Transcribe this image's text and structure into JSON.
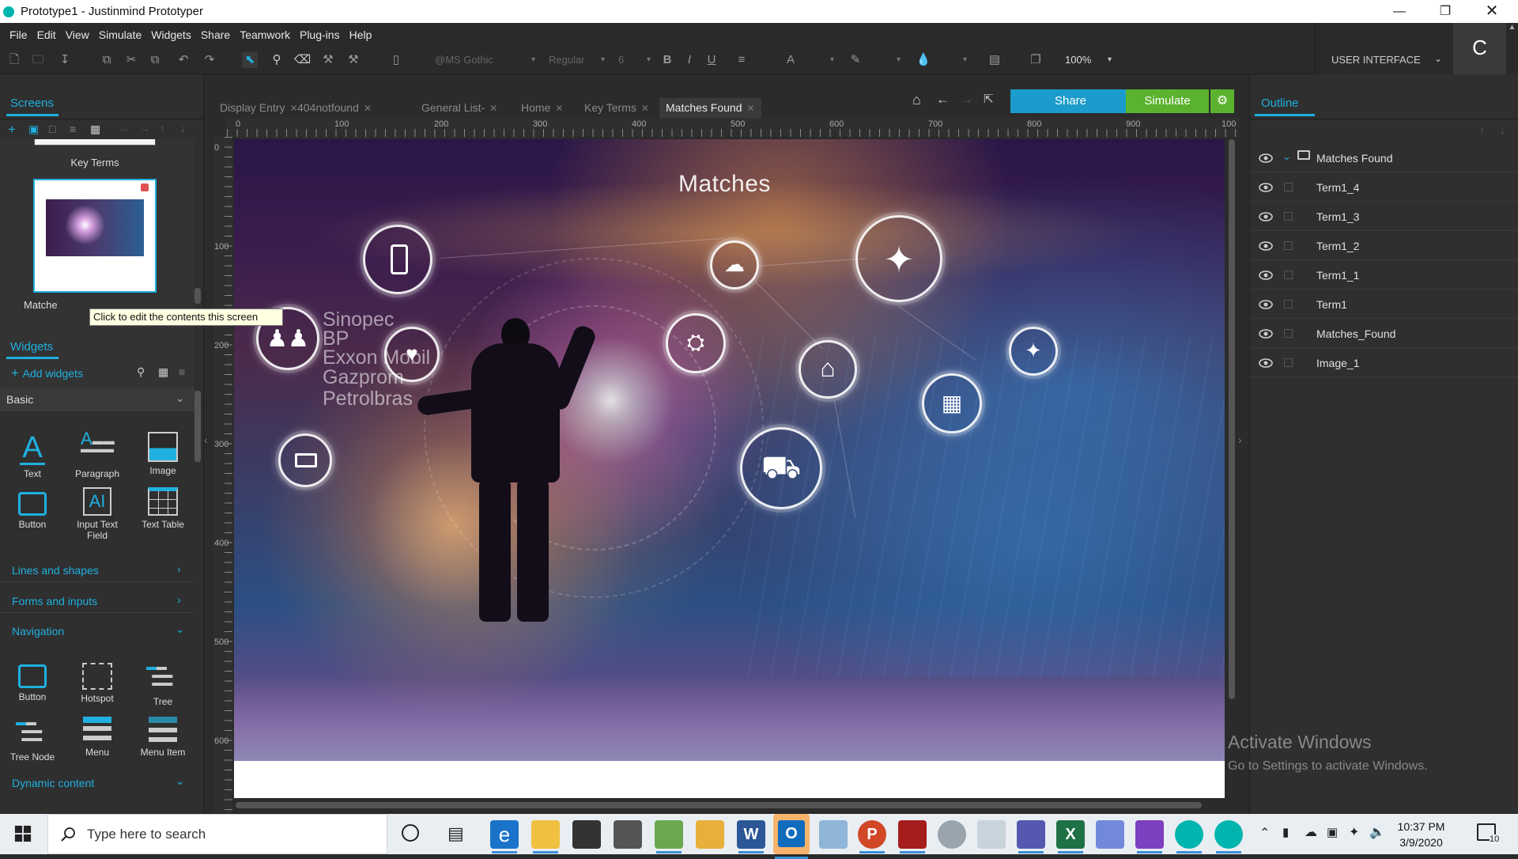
{
  "window": {
    "title": "Prototype1 - Justinmind Prototyper"
  },
  "menu": [
    "File",
    "Edit",
    "View",
    "Simulate",
    "Widgets",
    "Share",
    "Teamwork",
    "Plug-ins",
    "Help"
  ],
  "toolbar": {
    "font": "@MS Gothic",
    "style": "Regular",
    "size": "6",
    "zoom": "100%"
  },
  "ui_selector": "USER INTERFACE",
  "user_initial": "C",
  "screens_panel": {
    "title": "Screens",
    "items": [
      {
        "label": "Key Terms"
      },
      {
        "label": "Matches Found",
        "label_visible": "Matche"
      }
    ],
    "tooltip": "Click to edit the contents this screen"
  },
  "widgets_panel": {
    "title": "Widgets",
    "add_label": "Add widgets",
    "category": "Basic",
    "basic": [
      "Text",
      "Paragraph",
      "Image",
      "Button",
      "Input Text Field",
      "Text Table"
    ],
    "sections": [
      "Lines and shapes",
      "Forms and inputs",
      "Navigation"
    ],
    "navigation": [
      "Button",
      "Hotspot",
      "Tree",
      "Tree Node",
      "Menu",
      "Menu Item"
    ],
    "dynamic": "Dynamic content"
  },
  "tabs": [
    {
      "label": "Display Entry",
      "active": false
    },
    {
      "label": "404notfound",
      "active": false
    },
    {
      "label": "General List-",
      "active": false
    },
    {
      "label": "Home",
      "active": false
    },
    {
      "label": "Key Terms",
      "active": false
    },
    {
      "label": "Matches Found",
      "active": true
    }
  ],
  "actions": {
    "share": "Share",
    "simulate": "Simulate"
  },
  "rulers": {
    "top": [
      "0",
      "100",
      "200",
      "300",
      "400",
      "500",
      "600",
      "700",
      "800",
      "900",
      "100"
    ],
    "left": [
      "0",
      "100",
      "200",
      "300",
      "400",
      "500",
      "600"
    ]
  },
  "canvas": {
    "title": "Matches",
    "terms": [
      "Sinopec",
      "BP",
      "Exxon Mobil",
      "Gazprom",
      "Petrolbras"
    ]
  },
  "outline": {
    "title": "Outline",
    "root": "Matches Found",
    "items": [
      "Term1_4",
      "Term1_3",
      "Term1_2",
      "Term1_1",
      "Term1",
      "Matches_Found",
      "Image_1"
    ]
  },
  "watermark": {
    "line1": "Activate Windows",
    "line2": "Go to Settings to activate Windows."
  },
  "taskbar": {
    "search_placeholder": "Type here to search",
    "time": "10:37 PM",
    "date": "3/9/2020",
    "notifications": "10"
  },
  "colors": {
    "accent": "#1fb0e0",
    "share": "#1b9ccc",
    "simulate": "#5bb22e"
  }
}
